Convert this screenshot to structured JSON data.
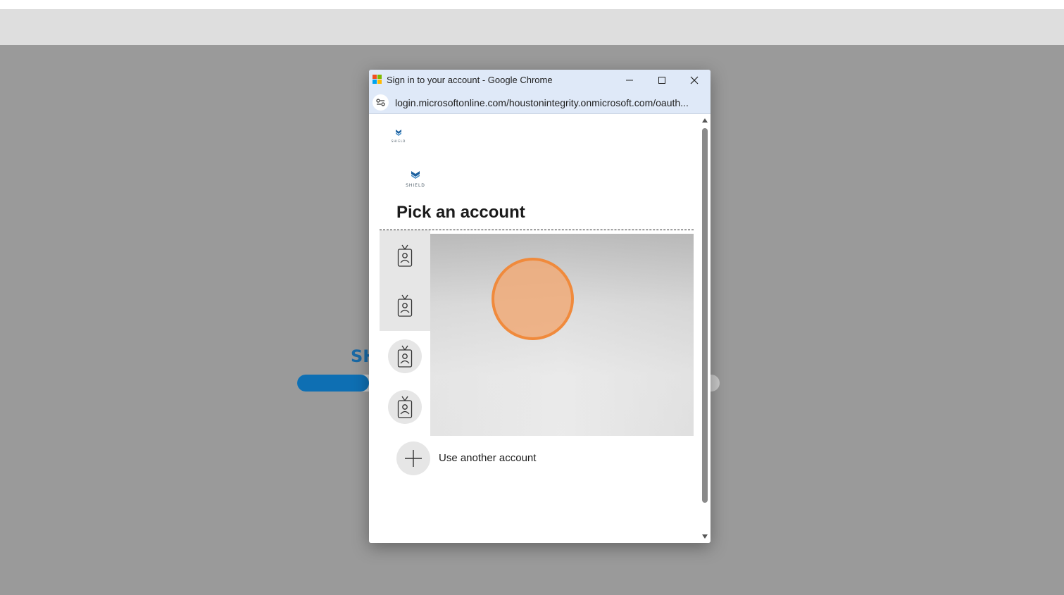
{
  "background_page": {
    "title_fragment": "SH",
    "progress_fraction": 0.17
  },
  "popup": {
    "window_title": "Sign in to your account - Google Chrome",
    "url": "login.microsoftonline.com/houstonintegrity.onmicrosoft.com/oauth...",
    "logo_text": "SHIELD",
    "heading": "Pick an account",
    "accounts_count_icons": [
      "account-badge-icon",
      "account-badge-icon",
      "account-badge-icon",
      "account-badge-icon"
    ],
    "use_another_account_label": "Use another account"
  },
  "colors": {
    "accent_blue": "#0e6fb3",
    "titlebar": "#dfe9f8",
    "click_marker": "#f08a3c"
  }
}
